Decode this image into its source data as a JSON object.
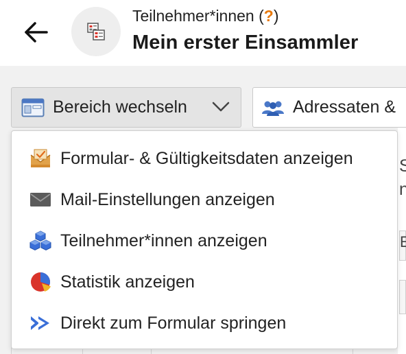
{
  "header": {
    "subtitle": "Teilnehmer*innen",
    "help_mark": "?",
    "title": "Mein erster Einsammler"
  },
  "toolbar": {
    "switch_area_label": "Bereich wechseln",
    "recipients_label": "Adressaten &"
  },
  "menu": {
    "items": [
      {
        "label": "Formular- & Gültigkeitsdaten anzeigen",
        "icon": "form-envelope-icon"
      },
      {
        "label": "Mail-Einstellungen anzeigen",
        "icon": "mail-icon"
      },
      {
        "label": "Teilnehmer*innen anzeigen",
        "icon": "cubes-icon"
      },
      {
        "label": "Statistik anzeigen",
        "icon": "pie-chart-icon"
      },
      {
        "label": "Direkt zum Formular springen",
        "icon": "fast-forward-icon"
      }
    ]
  },
  "background": {
    "glyph_1": "S",
    "glyph_2": "n",
    "glyph_3": "E"
  },
  "colors": {
    "accent_orange": "#e87a0e",
    "icon_blue": "#3a6fd8",
    "icon_red": "#d9342b",
    "icon_gray": "#555555"
  }
}
